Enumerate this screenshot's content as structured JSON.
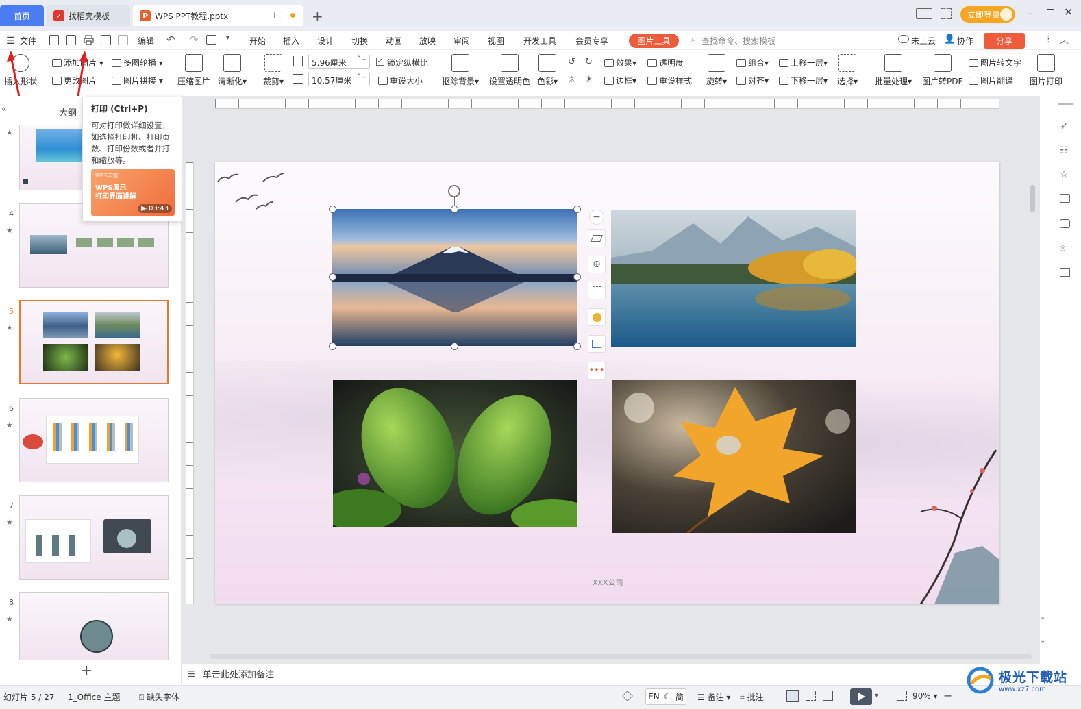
{
  "tabs": {
    "home": "首页",
    "docer": "找稻壳模板",
    "file": "WPS PPT教程.pptx"
  },
  "titlebar": {
    "login": "立即登录"
  },
  "menu": {
    "file": "文件",
    "edit": "编辑",
    "items": [
      "开始",
      "插入",
      "设计",
      "切换",
      "动画",
      "放映",
      "审阅",
      "视图",
      "开发工具",
      "会员专享"
    ],
    "picture_tools": "图片工具",
    "search_placeholder": "查找命令、搜索模板",
    "cloud": "未上云",
    "collab": "协作",
    "share": "分享"
  },
  "ribbon": {
    "insert_shape": "插入形状",
    "add_picture": "添加图片",
    "change_picture": "更改图片",
    "multi_carousel": "多图轮播",
    "picture_collage": "图片拼接",
    "compress": "压缩图片",
    "sharpen": "清晰化",
    "crop": "裁剪",
    "width": "5.96厘米",
    "height": "10.57厘米",
    "lock_ratio": "锁定纵横比",
    "reset_size": "重设大小",
    "remove_bg": "抠除背景",
    "set_transparent": "设置透明色",
    "color": "色彩",
    "effect": "效果",
    "border": "边框",
    "transparency": "透明度",
    "reset_style": "重设样式",
    "rotate": "旋转",
    "group": "组合",
    "align": "对齐",
    "bring_forward": "上移一层",
    "send_backward": "下移一层",
    "select": "选择",
    "batch": "批量处理",
    "to_pdf": "图片转PDF",
    "to_text": "图片转文字",
    "translate": "图片翻译",
    "print": "图片打印"
  },
  "panel": {
    "outline_label": "大纲"
  },
  "tooltip": {
    "title": "打印 (Ctrl+P)",
    "desc": "可对打印做详细设置，如选择打印机、打印页数、打印份数或者并打和缩放等。",
    "video_brand": "WPS学堂",
    "video_title": "WPS演示\n打印界面讲解",
    "video_time": "03:43"
  },
  "slides": [
    {
      "num": "4"
    },
    {
      "num": "5"
    },
    {
      "num": "6"
    },
    {
      "num": "7"
    },
    {
      "num": "8"
    }
  ],
  "slide": {
    "footer": "XXX公司"
  },
  "notes": {
    "placeholder": "单击此处添加备注"
  },
  "status": {
    "slide_info": "幻灯片 5 / 27",
    "theme": "1_Office 主题",
    "missing_font": "缺失字体",
    "lang": "EN",
    "lang2": "简",
    "notes": "备注",
    "comments": "批注",
    "zoom": "90%"
  },
  "watermark": {
    "text": "极光下载站",
    "url": "www.xz7.com"
  },
  "colors": {
    "accent_orange": "#e8782e",
    "home_tab": "#4c7cf3",
    "pic_tools": "#ee5a3a"
  }
}
